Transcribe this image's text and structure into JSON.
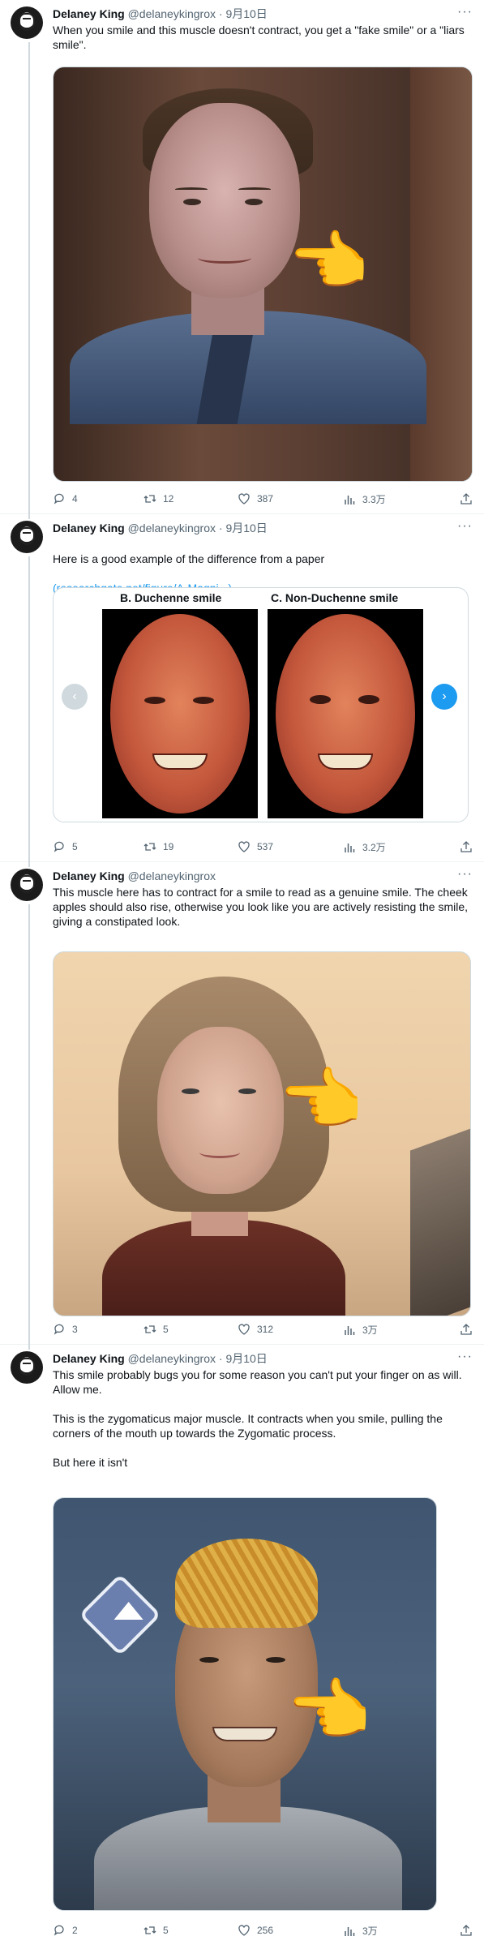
{
  "colors": {
    "text": "#0f1419",
    "secondary": "#536471",
    "link": "#1d9bf0",
    "divider": "#eff3f4",
    "thread_line": "#cfd9de"
  },
  "tweets": [
    {
      "author": {
        "name": "Delaney King",
        "handle": "@delaneykingrox",
        "sep": "·",
        "date": "9月10日"
      },
      "text": "When you smile and this muscle doesn't contract, you get a \"fake smile\" or a \"liars smile\".",
      "media": {
        "type": "image",
        "emoji": "👉"
      },
      "stats": {
        "replies": "4",
        "retweets": "12",
        "likes": "387",
        "views": "3.3万"
      }
    },
    {
      "author": {
        "name": "Delaney King",
        "handle": "@delaneykingrox",
        "sep": "·",
        "date": "9月10日"
      },
      "text": "Here is a good example of the difference from a paper",
      "link_text": "(researchgate.net/figure/A-Magni...)",
      "card": {
        "label_left": "B. Duchenne smile",
        "label_right": "C. Non-Duchenne smile",
        "prev_icon": "‹",
        "next_icon": "›"
      },
      "stats": {
        "replies": "5",
        "retweets": "19",
        "likes": "537",
        "views": "3.2万"
      }
    },
    {
      "author": {
        "name": "Delaney King",
        "handle": "@delaneykingrox",
        "sep": "",
        "date": ""
      },
      "text": "This muscle here has to contract for a smile to read as a genuine smile. The cheek apples should also rise, otherwise you look like you are actively resisting the smile, giving a constipated look.",
      "media": {
        "type": "image",
        "emoji": "👉"
      },
      "stats": {
        "replies": "3",
        "retweets": "5",
        "likes": "312",
        "views": "3万"
      }
    },
    {
      "author": {
        "name": "Delaney King",
        "handle": "@delaneykingrox",
        "sep": "·",
        "date": "9月10日"
      },
      "text": "This smile probably bugs you for some reason you can't put your finger on as will.  Allow me.\n\nThis is the zygomaticus major muscle.  It contracts when you smile, pulling the corners of the mouth up towards the Zygomatic process.\n\nBut here it isn't",
      "media": {
        "type": "image",
        "emoji": "👉"
      },
      "stats": {
        "replies": "2",
        "retweets": "5",
        "likes": "256",
        "views": "3万"
      }
    }
  ],
  "icons": {
    "reply": "reply-icon",
    "retweet": "retweet-icon",
    "like": "heart-icon",
    "views": "views-icon",
    "share": "share-icon",
    "more": "more-icon"
  },
  "more_label": "···"
}
